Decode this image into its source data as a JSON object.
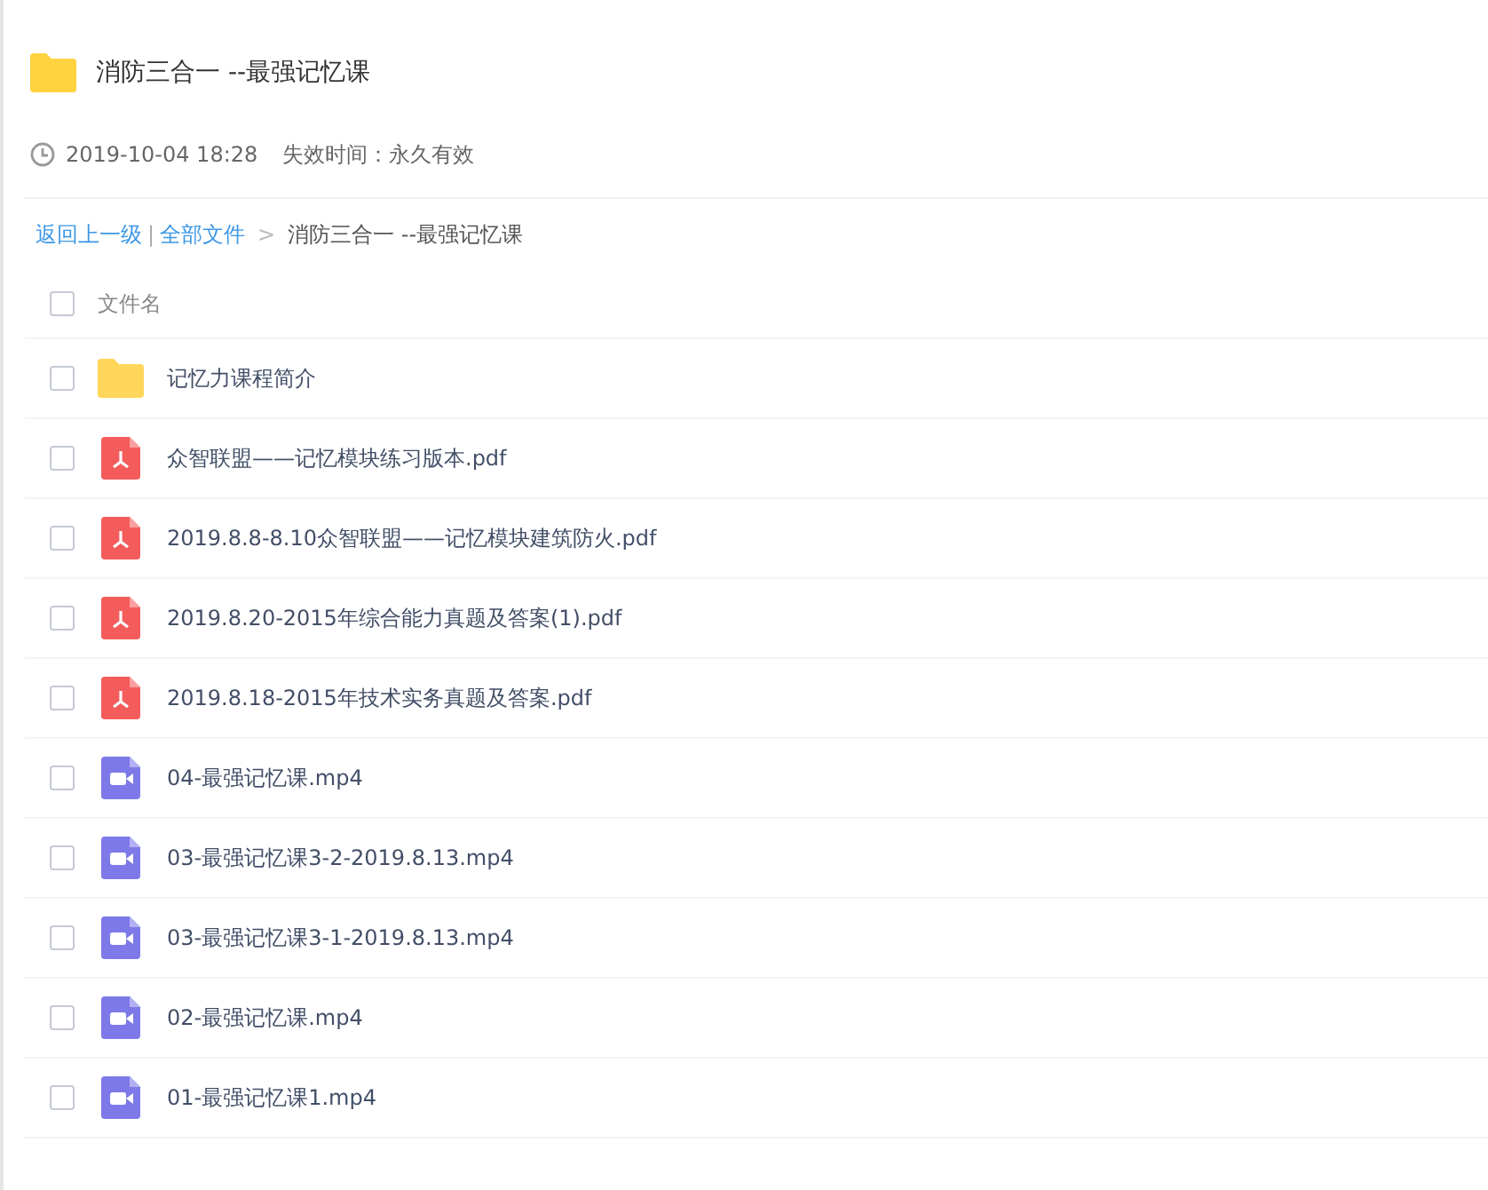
{
  "share": {
    "title": "消防三合一 --最强记忆课",
    "time": "2019-10-04 18:28",
    "expiry": "失效时间：永久有效"
  },
  "breadcrumb": {
    "back": "返回上一级",
    "separator": "|",
    "root": "全部文件",
    "arrow": ">",
    "current": "消防三合一 --最强记忆课"
  },
  "table": {
    "header": {
      "label": "文件名",
      "checked": false
    },
    "rows": [
      {
        "kind": "folder",
        "name": "记忆力课程简介",
        "checked": false
      },
      {
        "kind": "pdf",
        "name": "众智联盟——记忆模块练习版本.pdf",
        "checked": false
      },
      {
        "kind": "pdf",
        "name": "2019.8.8-8.10众智联盟——记忆模块建筑防火.pdf",
        "checked": false
      },
      {
        "kind": "pdf",
        "name": "2019.8.20-2015年综合能力真题及答案(1).pdf",
        "checked": false
      },
      {
        "kind": "pdf",
        "name": "2019.8.18-2015年技术实务真题及答案.pdf",
        "checked": false
      },
      {
        "kind": "video",
        "name": "04-最强记忆课.mp4",
        "checked": false
      },
      {
        "kind": "video",
        "name": "03-最强记忆课3-2-2019.8.13.mp4",
        "checked": false
      },
      {
        "kind": "video",
        "name": "03-最强记忆课3-1-2019.8.13.mp4",
        "checked": false
      },
      {
        "kind": "video",
        "name": "02-最强记忆课.mp4",
        "checked": false
      },
      {
        "kind": "video",
        "name": "01-最强记忆课1.mp4",
        "checked": false
      }
    ]
  }
}
